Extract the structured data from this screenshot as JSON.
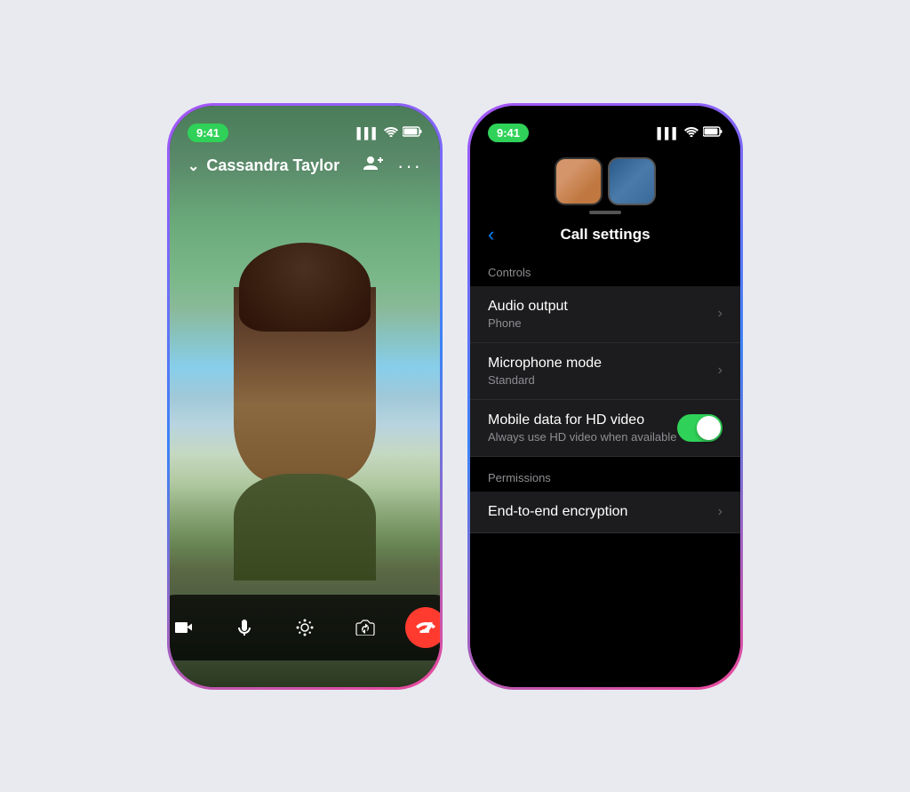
{
  "page": {
    "background": "#e8eaf0"
  },
  "left_phone": {
    "status_bar": {
      "time": "9:41",
      "signal": "▌▌▌",
      "wifi": "wifi",
      "battery": "battery"
    },
    "call_header": {
      "chevron": "chevron",
      "contact_name": "Cassandra Taylor",
      "add_person_icon": "add-person",
      "more_icon": "more"
    },
    "controls": {
      "video_icon": "video",
      "mic_icon": "mic",
      "effects_icon": "effects",
      "flip_icon": "flip",
      "end_call_icon": "end-call"
    }
  },
  "right_phone": {
    "status_bar": {
      "time": "9:41"
    },
    "nav": {
      "back_label": "‹",
      "title": "Call settings"
    },
    "sections": {
      "controls_header": "Controls",
      "permissions_header": "Permissions"
    },
    "rows": {
      "audio_output": {
        "title": "Audio output",
        "subtitle": "Phone"
      },
      "microphone_mode": {
        "title": "Microphone mode",
        "subtitle": "Standard"
      },
      "mobile_data": {
        "title": "Mobile data for HD video",
        "subtitle": "Always use HD video when available",
        "toggle_on": true
      },
      "encryption": {
        "title": "End-to-end encryption",
        "has_chevron": true
      }
    }
  }
}
